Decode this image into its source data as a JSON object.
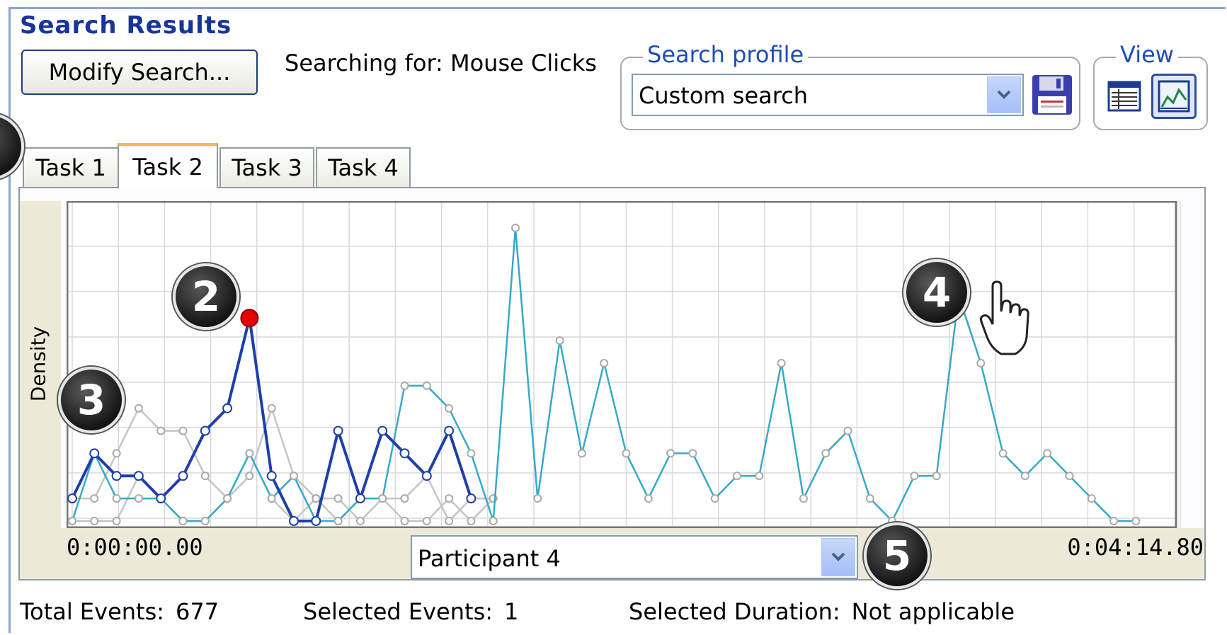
{
  "panel": {
    "title": "Search Results"
  },
  "toolbar": {
    "modify_label": "Modify Search...",
    "searching_text": "Searching for: Mouse Clicks"
  },
  "profile": {
    "legend": "Search profile",
    "selected": "Custom search"
  },
  "view": {
    "legend": "View",
    "active": "chart"
  },
  "tabs": [
    {
      "label": "Task 1",
      "active": false
    },
    {
      "label": "Task 2",
      "active": true
    },
    {
      "label": "Task 3",
      "active": false
    },
    {
      "label": "Task 4",
      "active": false
    }
  ],
  "chart": {
    "ylabel": "Density",
    "start_time": "0:00:00.00",
    "end_time": "0:04:14.80",
    "participant": "Participant 4"
  },
  "chart_data": {
    "type": "line",
    "ylabel": "Density",
    "x_range": [
      "0:00:00.00",
      "0:04:14.80"
    ],
    "ylim": [
      0,
      14
    ],
    "grid": true,
    "series": [
      {
        "values": [
          1,
          3,
          2,
          2,
          1,
          2,
          4,
          5,
          9,
          2,
          0,
          0,
          4,
          1,
          4,
          3,
          2,
          4,
          1
        ],
        "color": "#1f3fa8",
        "selected": true
      },
      {
        "values": [
          0,
          3,
          1,
          1,
          1,
          0,
          0,
          1,
          3,
          1,
          2,
          0,
          0,
          1,
          1,
          6,
          6,
          5,
          3,
          0,
          13,
          1,
          8,
          3,
          7,
          3,
          1,
          3,
          3,
          1,
          2,
          2,
          7,
          1,
          3,
          4,
          1,
          0,
          2,
          2,
          10,
          7,
          3,
          2,
          3,
          2,
          1,
          0,
          0
        ],
        "color": "#36a9c9"
      },
      {
        "values": [
          1,
          1,
          3,
          5,
          4,
          4,
          2,
          1,
          2,
          5,
          2,
          1,
          0,
          1,
          1,
          1,
          2,
          0,
          1,
          1
        ],
        "color": "#c4c4c4"
      },
      {
        "values": [
          0,
          0,
          0,
          2,
          1,
          0,
          0,
          1,
          3,
          1,
          0,
          1,
          1,
          0,
          1,
          0,
          0,
          1,
          0,
          1
        ],
        "color": "#c4c4c4"
      }
    ],
    "selected_point": {
      "series": 0,
      "index": 8,
      "color": "#e60000"
    }
  },
  "status": {
    "total_label": "Total Events:",
    "total_value": "677",
    "selected_label": "Selected Events:",
    "selected_value": "1",
    "duration_label": "Selected Duration:",
    "duration_value": "Not applicable"
  },
  "callouts": [
    "2",
    "3",
    "4",
    "5"
  ]
}
